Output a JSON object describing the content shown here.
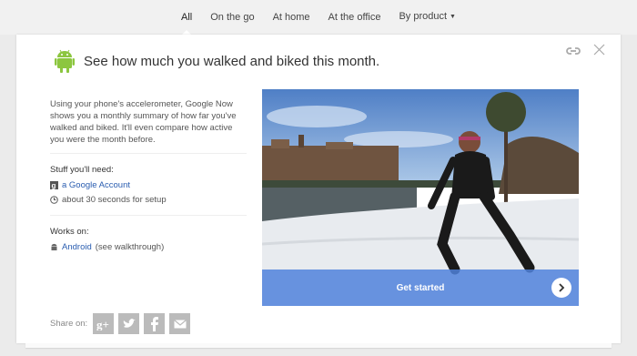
{
  "nav": {
    "tabs": [
      {
        "label": "All"
      },
      {
        "label": "On the go"
      },
      {
        "label": "At home"
      },
      {
        "label": "At the office"
      },
      {
        "label": "By product"
      }
    ]
  },
  "card": {
    "title": "See how much you walked and biked this month.",
    "description": "Using your phone's accelerometer, Google Now shows you a monthly summary of how far you've walked and biked. It'll even compare how active you were the month before.",
    "stuff_label": "Stuff you'll need:",
    "stuff_items": [
      {
        "text": "a Google Account",
        "icon": "google-icon"
      },
      {
        "text": "about 30 seconds for setup",
        "icon": "clock-icon"
      }
    ],
    "works_label": "Works on:",
    "works_link": "Android",
    "works_suffix": " (see walkthrough)",
    "cta_label": "Get started",
    "share_label": "Share on:"
  },
  "colors": {
    "link": "#2a5db0",
    "android": "#8cc63f",
    "cta": "#5082dc"
  }
}
